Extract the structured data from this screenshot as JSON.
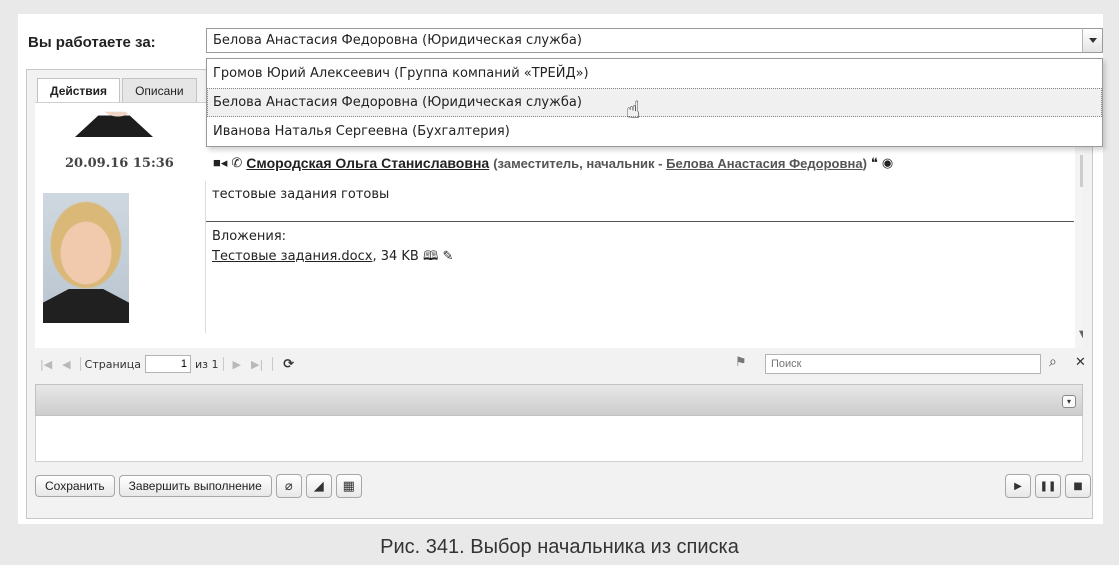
{
  "work_as": {
    "label": "Вы работаете за:",
    "selected": "Белова Анастасия Федоровна (Юридическая служба)",
    "options": [
      "Громов Юрий Алексеевич (Группа компаний «ТРЕЙД»)",
      "Белова Анастасия Федоровна (Юридическая служба)",
      "Иванова Наталья Сергеевна (Бухгалтерия)"
    ]
  },
  "tabs": [
    "Действия",
    "Описани"
  ],
  "message": {
    "datetime": "20.09.16 15:36",
    "author": "Смородская Ольга Станиславовна",
    "role_prefix": "(заместитель, начальник - ",
    "boss": "Белова Анастасия Федоровна",
    "role_suffix": ")",
    "text": "тестовые задания готовы",
    "attachments_label": "Вложения:",
    "attachment_name": "Тестовые задания.docx",
    "attachment_size": ", 34 KB"
  },
  "pager": {
    "page_label": "Страница",
    "page_value": "1",
    "of_label": "из 1",
    "search_placeholder": "Поиск"
  },
  "buttons": {
    "save": "Сохранить",
    "complete": "Завершить выполнение"
  },
  "icons": {
    "dropdown": "chevron-down-icon",
    "video": "video-camera-icon",
    "phone": "phone-icon",
    "quote": "quote-icon",
    "eye": "eye-icon",
    "attach": "paperclip-icon",
    "sign": "sign-icon",
    "structure": "org-chart-icon",
    "play": "play-icon",
    "pause": "pause-icon",
    "stop": "stop-icon"
  },
  "caption": "Рис. 341. Выбор начальника из списка"
}
